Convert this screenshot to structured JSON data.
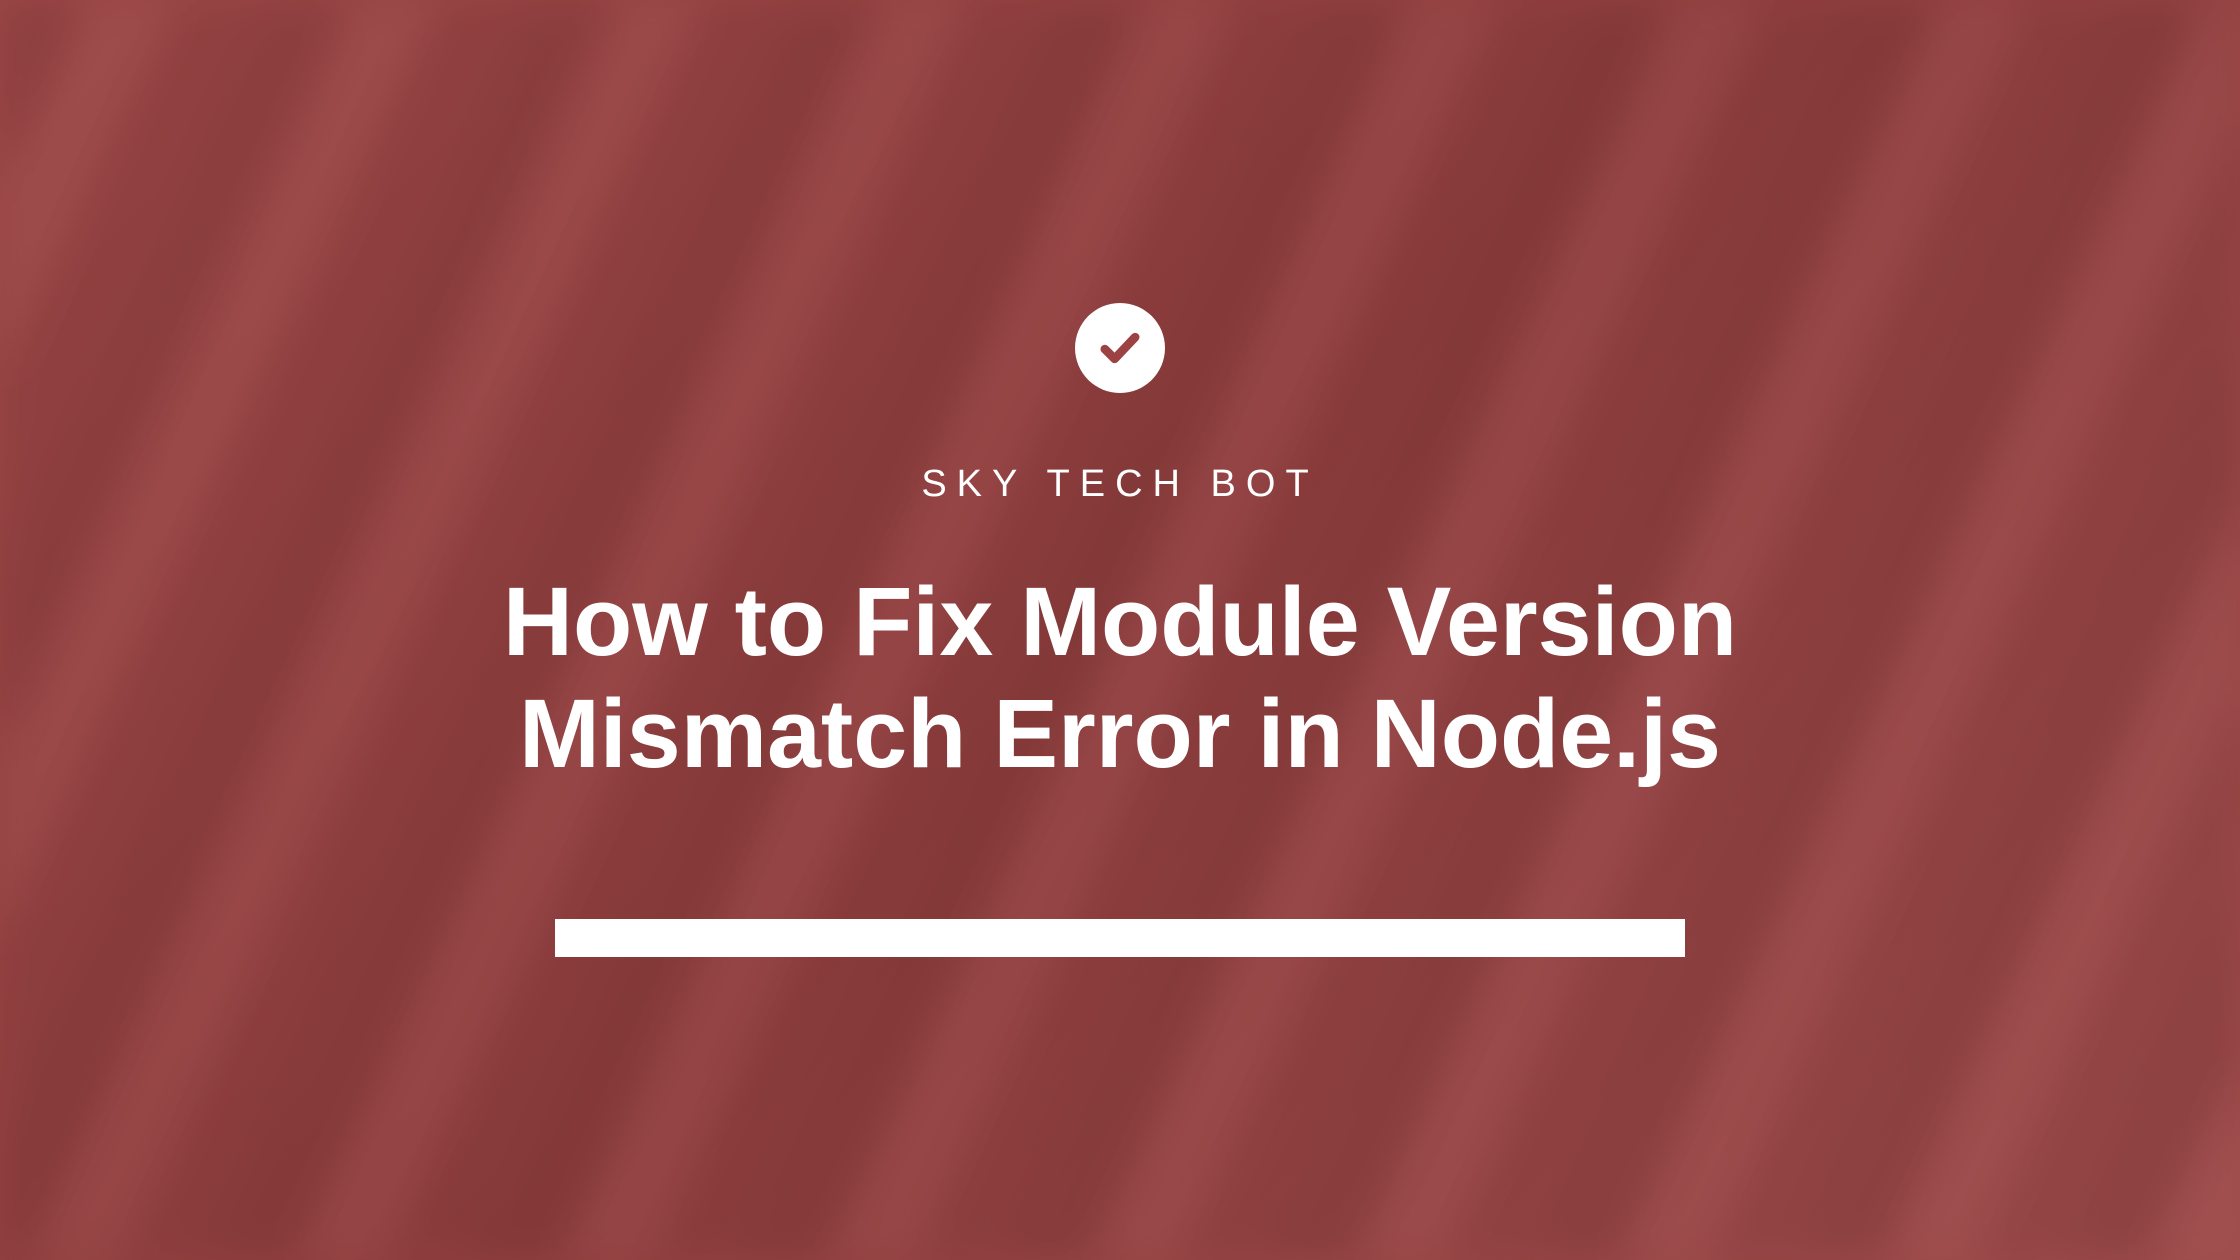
{
  "subtitle": "SKY TECH BOT",
  "title": "How to Fix Module Version Mismatch Error in Node.js",
  "accent_color": "#9d4242",
  "text_color": "#ffffff"
}
